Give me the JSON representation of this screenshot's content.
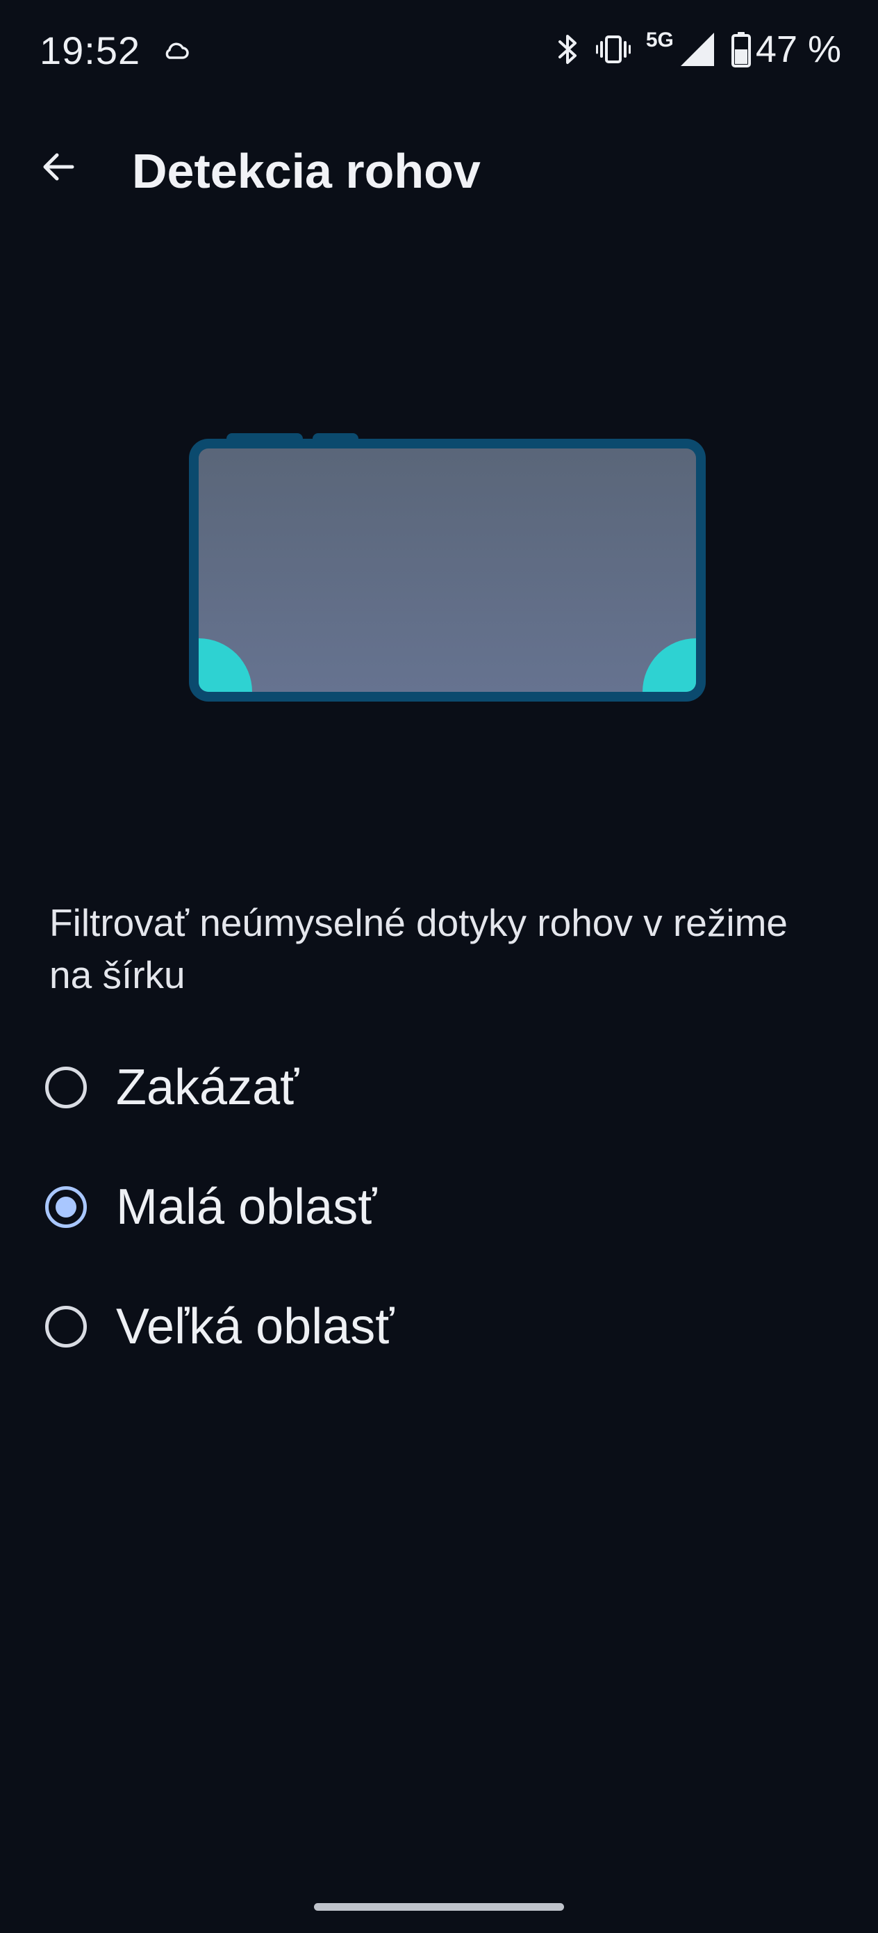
{
  "status_bar": {
    "time": "19:52",
    "network": "5G",
    "battery": "47 %",
    "icons": [
      "weather-cloud-icon",
      "bluetooth-icon",
      "vibrate-icon",
      "signal-icon",
      "battery-icon"
    ]
  },
  "app_bar": {
    "back_icon": "arrow-back-icon",
    "title": "Detekcia rohov"
  },
  "illustration": {
    "frame_color": "#0b4a6e",
    "screen_color": "#5f6b82",
    "corner_color": "#2ed2d2"
  },
  "description": "Filtrovať neúmyselné dotyky rohov v režime na šírku",
  "options": [
    {
      "label": "Zakázať",
      "selected": false
    },
    {
      "label": "Malá oblasť",
      "selected": true
    },
    {
      "label": "Veľká oblasť",
      "selected": false
    }
  ],
  "colors": {
    "background": "#0a0e17",
    "accent": "#a9c7ff"
  }
}
